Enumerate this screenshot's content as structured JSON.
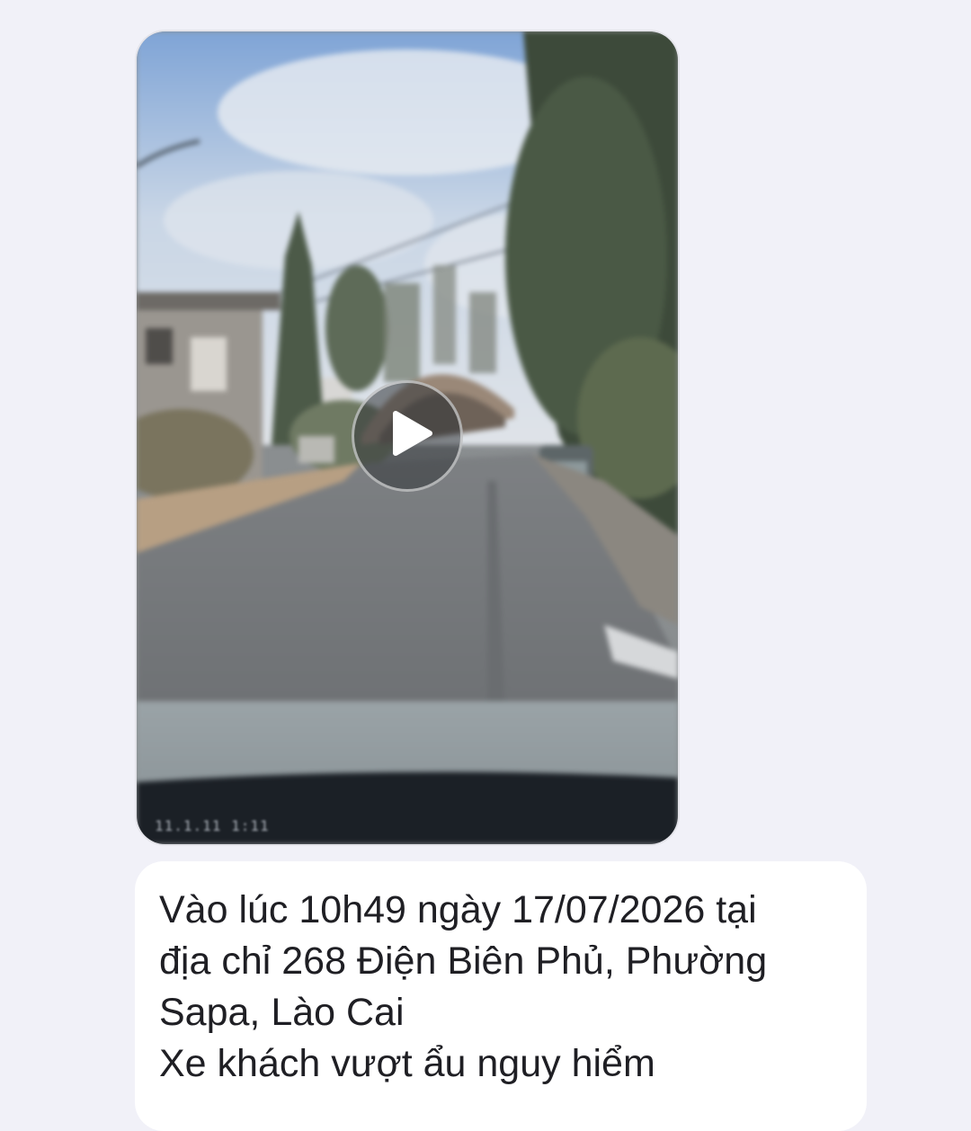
{
  "chat": {
    "video_message": {
      "has_play_button": true,
      "overlay_timestamp": "11.1.11 1:11"
    },
    "text_message": {
      "lines": [
        "Vào lúc 10h49 ngày 17/07/2026 tại",
        "địa chỉ 268 Điện Biên Phủ, Phường",
        "Sapa, Lào Cai",
        "Xe khách vượt ẩu nguy hiểm"
      ]
    }
  },
  "colors": {
    "background": "#f1f1f8",
    "bubble": "#ffffff",
    "text": "#1f1f24"
  },
  "icons": {
    "play": "play-icon"
  }
}
